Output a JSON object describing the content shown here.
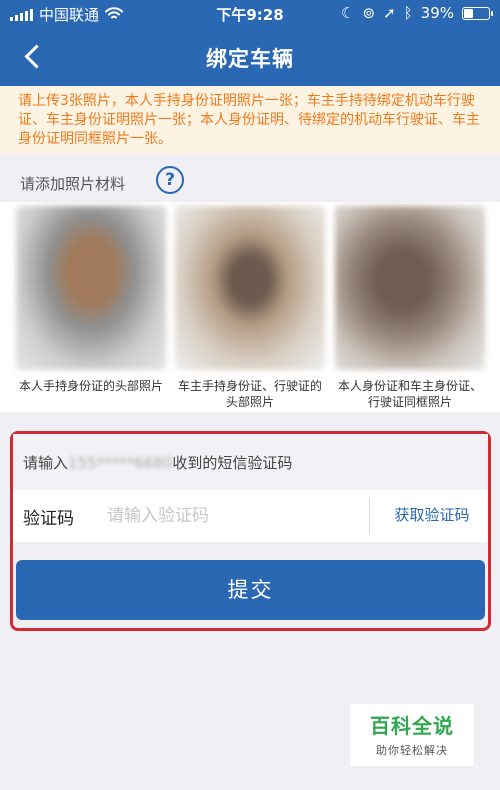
{
  "status_bar": {
    "carrier": "中国联通",
    "time": "下午9:28",
    "battery": "39%",
    "battery_level": 0.39
  },
  "header": {
    "title": "绑定车辆"
  },
  "notice": "请上传3张照片，本人手持身份证明照片一张；车主手持待绑定机动车行驶证、车主身份证明照片一张；本人身份证明、待绑定的机动车行驶证、车主身份证明同框照片一张。",
  "photos": {
    "label": "请添加照片材料",
    "help_glyph": "?",
    "items": [
      {
        "caption": "本人手持身份证的头部照片"
      },
      {
        "caption": "车主手持身份证、行驶证的头部照片"
      },
      {
        "caption": "本人身份证和车主身份证、行驶证同框照片"
      }
    ]
  },
  "verify": {
    "prefix": "请输入",
    "phone": "155*****6680",
    "suffix": "收到的短信验证码",
    "code_label": "验证码",
    "code_placeholder": "请输入验证码",
    "get_code": "获取验证码",
    "submit": "提交"
  },
  "watermark": {
    "brand": "百科全说",
    "slogan": "助你轻松解决"
  },
  "colors": {
    "primary": "#2a68b3",
    "notice_text": "#ee7a1c",
    "highlight_border": "#d22b34",
    "watermark": "#2fa84f"
  }
}
